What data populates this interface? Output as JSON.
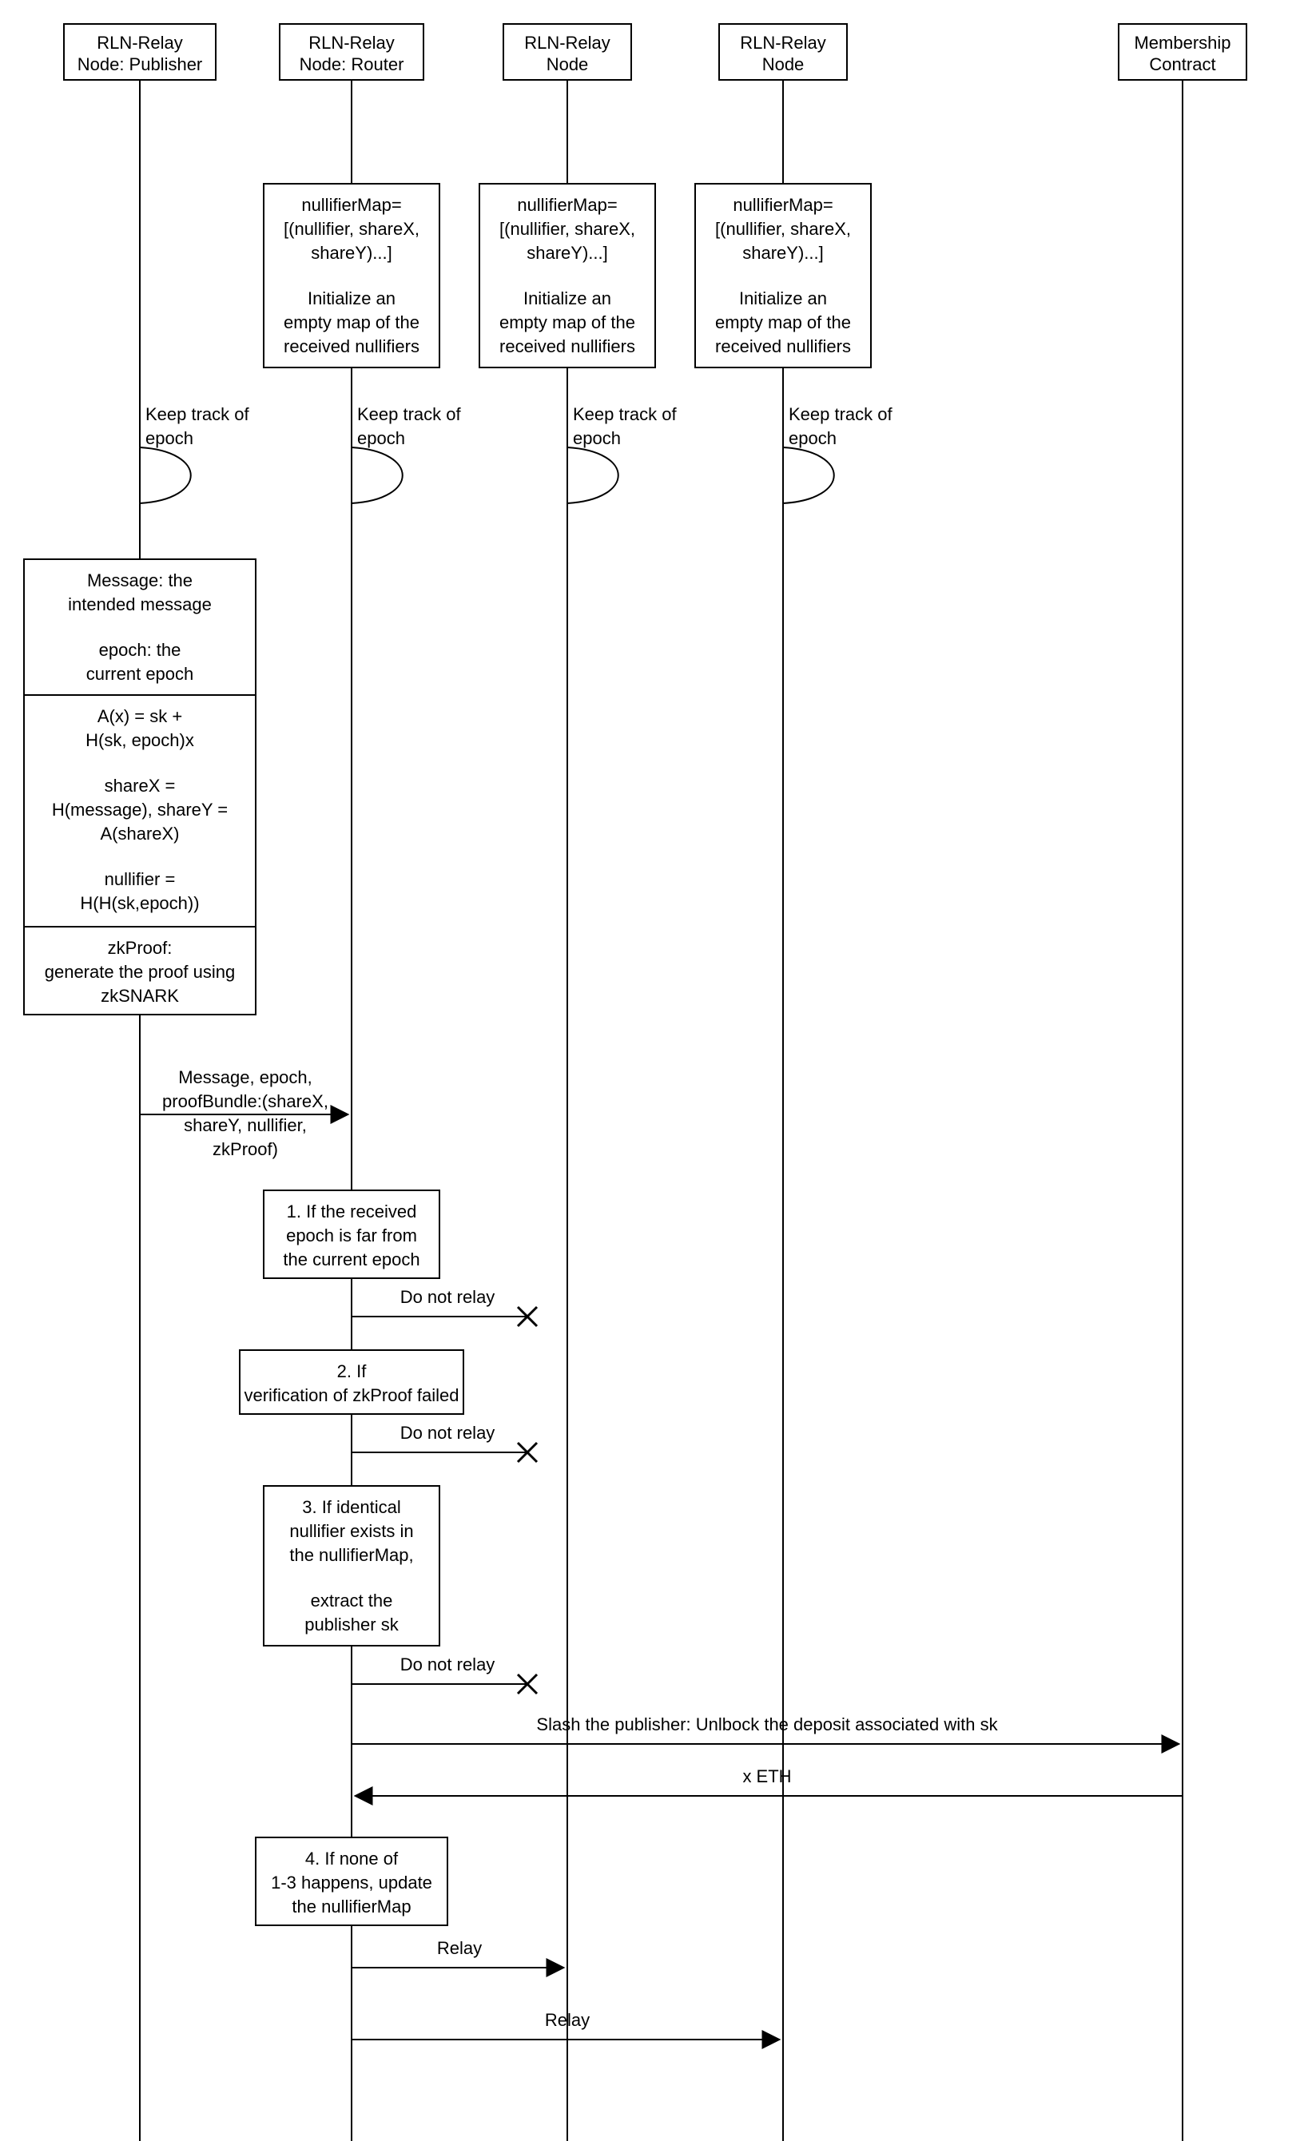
{
  "actors": {
    "publisher": {
      "line1": "RLN-Relay",
      "line2": "Node: Publisher"
    },
    "router": {
      "line1": "RLN-Relay",
      "line2": "Node: Router"
    },
    "node3": {
      "line1": "RLN-Relay",
      "line2": "Node"
    },
    "node4": {
      "line1": "RLN-Relay",
      "line2": "Node"
    },
    "contract": {
      "line1": "Membership",
      "line2": "Contract"
    }
  },
  "notes": {
    "initMap": {
      "l1": "nullifierMap=",
      "l2": "[(nullifier, shareX,",
      "l3": "shareY)...]",
      "l4": "Initialize an",
      "l5": "empty map of the",
      "l6": "received nullifiers"
    },
    "epochSelf": {
      "l1": "Keep track of",
      "l2": "epoch"
    },
    "msgEpoch": {
      "l1": "Message: the",
      "l2": "intended message",
      "l3": "epoch: the",
      "l4": "current epoch"
    },
    "ax": {
      "l1": "A(x) = sk +",
      "l2": "H(sk, epoch)x",
      "l3": "shareX =",
      "l4": "H(message), shareY =",
      "l5": "A(shareX)",
      "l6": "nullifier =",
      "l7": "H(H(sk,epoch))"
    },
    "zk": {
      "l1": "zkProof:",
      "l2": "generate the proof using",
      "l3": "zkSNARK"
    },
    "sendMsg": {
      "l1": "Message, epoch,",
      "l2": "proofBundle:(shareX,",
      "l3": "shareY, nullifier,",
      "l4": "zkProof)"
    },
    "check1": {
      "l1": "1. If the received",
      "l2": "epoch is far from",
      "l3": "the current epoch"
    },
    "check2": {
      "l1": "2. If",
      "l2": "verification of zkProof failed"
    },
    "check3": {
      "l1": "3. If identical",
      "l2": "nullifier exists in",
      "l3": "the nullifierMap,",
      "l4": "extract the",
      "l5": "publisher sk"
    },
    "check4": {
      "l1": "4. If none of",
      "l2": "1-3 happens, update",
      "l3": "the nullifierMap"
    }
  },
  "labels": {
    "doNotRelay": "Do not relay",
    "slash": "Slash the publisher: Unlbock the deposit associated with sk",
    "xeth": "x ETH",
    "relay": "Relay"
  }
}
